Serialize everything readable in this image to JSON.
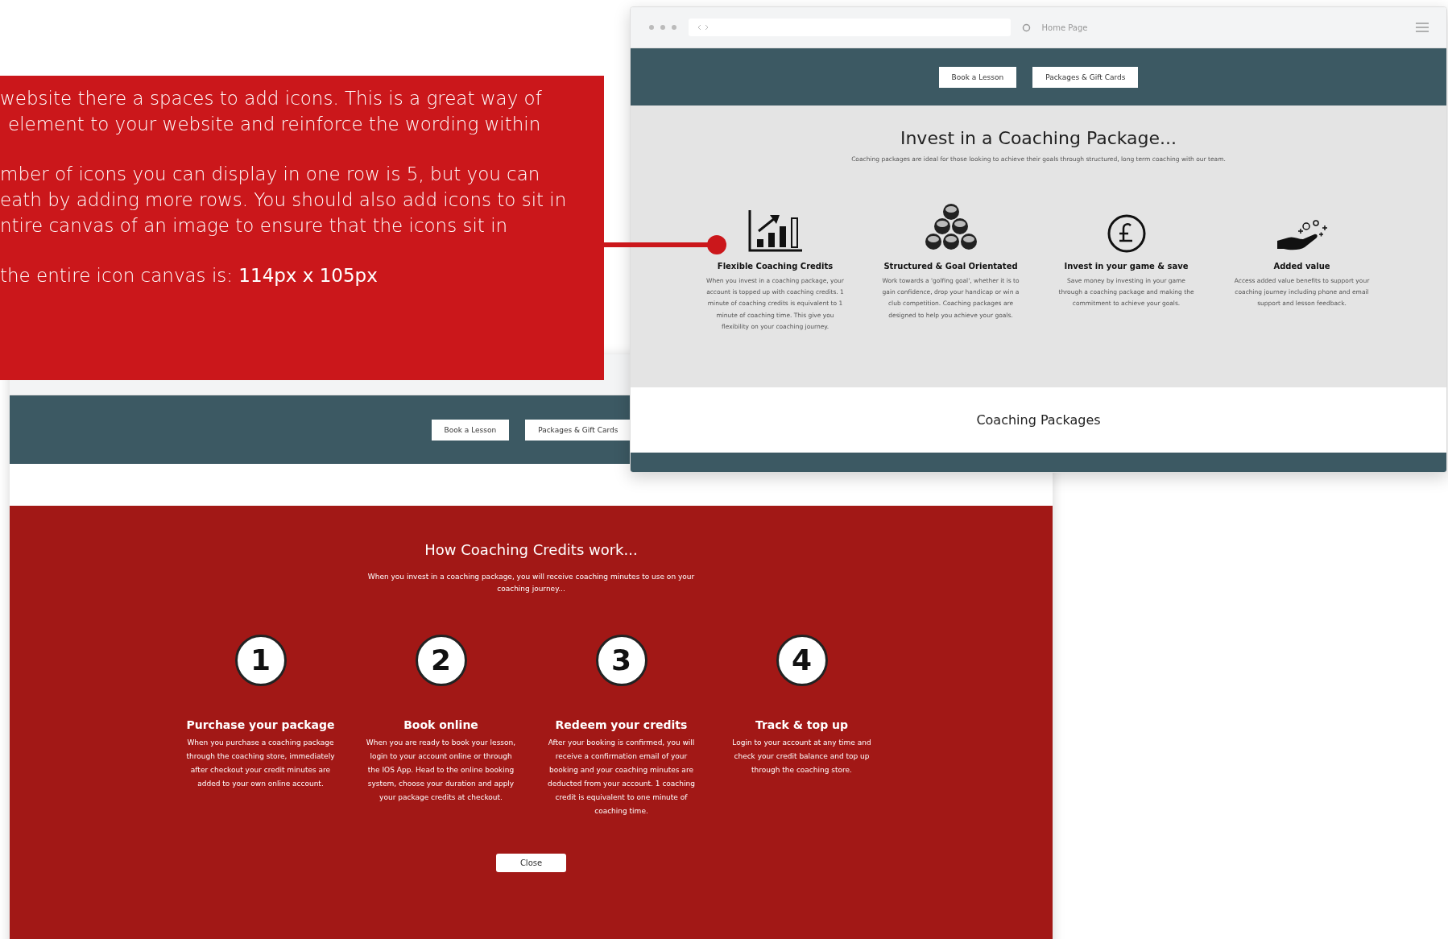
{
  "callout": {
    "paragraphs": [
      [
        "website there a spaces to add icons. This is a great way of",
        "element to your website and reinforce the wording within"
      ],
      [
        "mber of icons you can display in one row is 5, but you can",
        "eath by adding more rows. You should also add icons to sit in",
        "ntire canvas of an image to ensure that the icons sit in"
      ],
      [
        "the entire icon canvas is: **114px x 105px**"
      ]
    ]
  },
  "top_window": {
    "address_bar": {
      "page_title": "Home Page"
    },
    "nav_buttons": [
      "Book a Lesson",
      "Packages & Gift Cards"
    ],
    "title": "Invest in a Coaching Package...",
    "subtitle": "Coaching packages are ideal for those looking to achieve their goals through structured, long term coaching with our team.",
    "features": [
      {
        "kind": "chart",
        "title": "Flexible Coaching Credits",
        "description": "When you invest in a coaching package, your account is topped up with coaching credits. 1 minute of coaching credits is equivalent to 1 minute of coaching time. This give you flexibility on your coaching journey."
      },
      {
        "kind": "balls",
        "title": "Structured & Goal Orientated",
        "description": "Work towards a 'golfing goal', whether it is to gain confidence, drop your handicap or win a club competition. Coaching packages are designed to help you achieve your goals."
      },
      {
        "kind": "pound",
        "title": "Invest in your game & save",
        "description": "Save money by investing in your game through a coaching package and making the commitment to achieve your goals."
      },
      {
        "kind": "hand",
        "title": "Added value",
        "description": "Access added value benefits to support your coaching journey including phone and email support and lesson feedback."
      }
    ],
    "section_heading": "Coaching Packages"
  },
  "bottom_window": {
    "nav_buttons": [
      "Book a Lesson",
      "Packages & Gift Cards"
    ],
    "title": "How Coaching Credits work...",
    "subtitle": "When you invest in a coaching package, you will receive coaching minutes to use on your coaching journey...",
    "steps": [
      {
        "number": "1",
        "title": "Purchase your package",
        "description": "When you purchase a coaching package through the coaching store, immediately after checkout your credit minutes are added to your own online account."
      },
      {
        "number": "2",
        "title": "Book online",
        "description": "When you are ready to book your lesson, login to your account online or through the IOS App. Head to the online booking system, choose your duration and apply your package credits at checkout."
      },
      {
        "number": "3",
        "title": "Redeem your credits",
        "description": "After your booking is confirmed, you will receive a confirmation email of your booking and your coaching minutes are deducted from your account. 1 coaching credit is equivalent to one minute of coaching time."
      },
      {
        "number": "4",
        "title": "Track & top up",
        "description": "Login to your account at any time and check your credit balance and top up through the coaching store."
      }
    ],
    "close_button": "Close"
  }
}
